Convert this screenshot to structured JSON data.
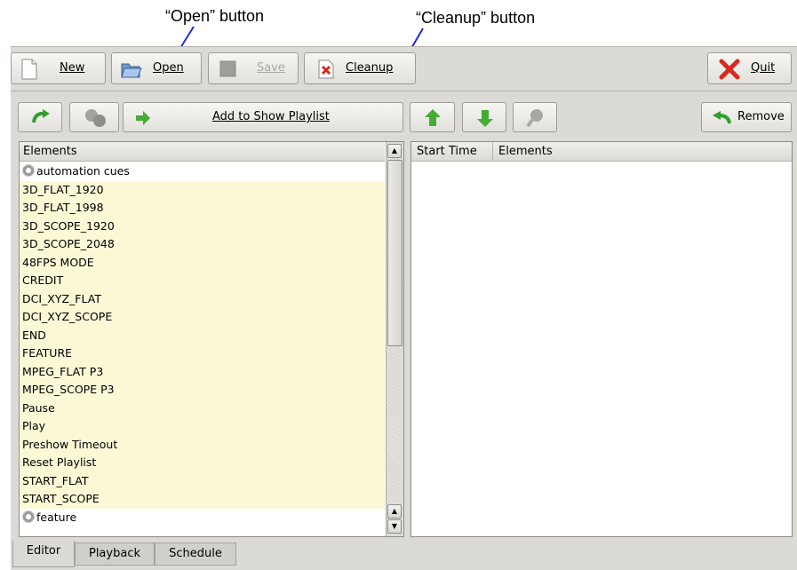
{
  "annotations": {
    "open_callout": "“Open” button",
    "cleanup_callout": "“Cleanup” button"
  },
  "toolbar": {
    "new_label": "New",
    "open_label": "Open",
    "save_label": "Save",
    "cleanup_label": "Cleanup",
    "quit_label": "Quit"
  },
  "playlist_toolbar": {
    "add_label": "Add to Show Playlist",
    "remove_label": "Remove"
  },
  "elements_panel": {
    "header": "Elements",
    "items": [
      {
        "label": "automation cues",
        "type": "group"
      },
      {
        "label": "3D_FLAT_1920",
        "type": "cue"
      },
      {
        "label": "3D_FLAT_1998",
        "type": "cue"
      },
      {
        "label": "3D_SCOPE_1920",
        "type": "cue"
      },
      {
        "label": "3D_SCOPE_2048",
        "type": "cue"
      },
      {
        "label": "48FPS MODE",
        "type": "cue"
      },
      {
        "label": "CREDIT",
        "type": "cue"
      },
      {
        "label": "DCI_XYZ_FLAT",
        "type": "cue"
      },
      {
        "label": "DCI_XYZ_SCOPE",
        "type": "cue"
      },
      {
        "label": "END",
        "type": "cue"
      },
      {
        "label": "FEATURE",
        "type": "cue"
      },
      {
        "label": "MPEG_FLAT P3",
        "type": "cue"
      },
      {
        "label": "MPEG_SCOPE P3",
        "type": "cue"
      },
      {
        "label": "Pause",
        "type": "cue"
      },
      {
        "label": "Play",
        "type": "cue"
      },
      {
        "label": "Preshow Timeout",
        "type": "cue"
      },
      {
        "label": "Reset Playlist",
        "type": "cue"
      },
      {
        "label": "START_FLAT",
        "type": "cue"
      },
      {
        "label": "START_SCOPE",
        "type": "cue"
      },
      {
        "label": "feature",
        "type": "group"
      }
    ]
  },
  "playlist_panel": {
    "col_start_time": "Start Time",
    "col_elements": "Elements"
  },
  "tabs": [
    "Editor",
    "Playback",
    "Schedule"
  ],
  "colors": {
    "cue_row_bg": "#fbf8d6",
    "window_bg": "#dcdad5",
    "callout_arrow": "#1f2bd6"
  }
}
